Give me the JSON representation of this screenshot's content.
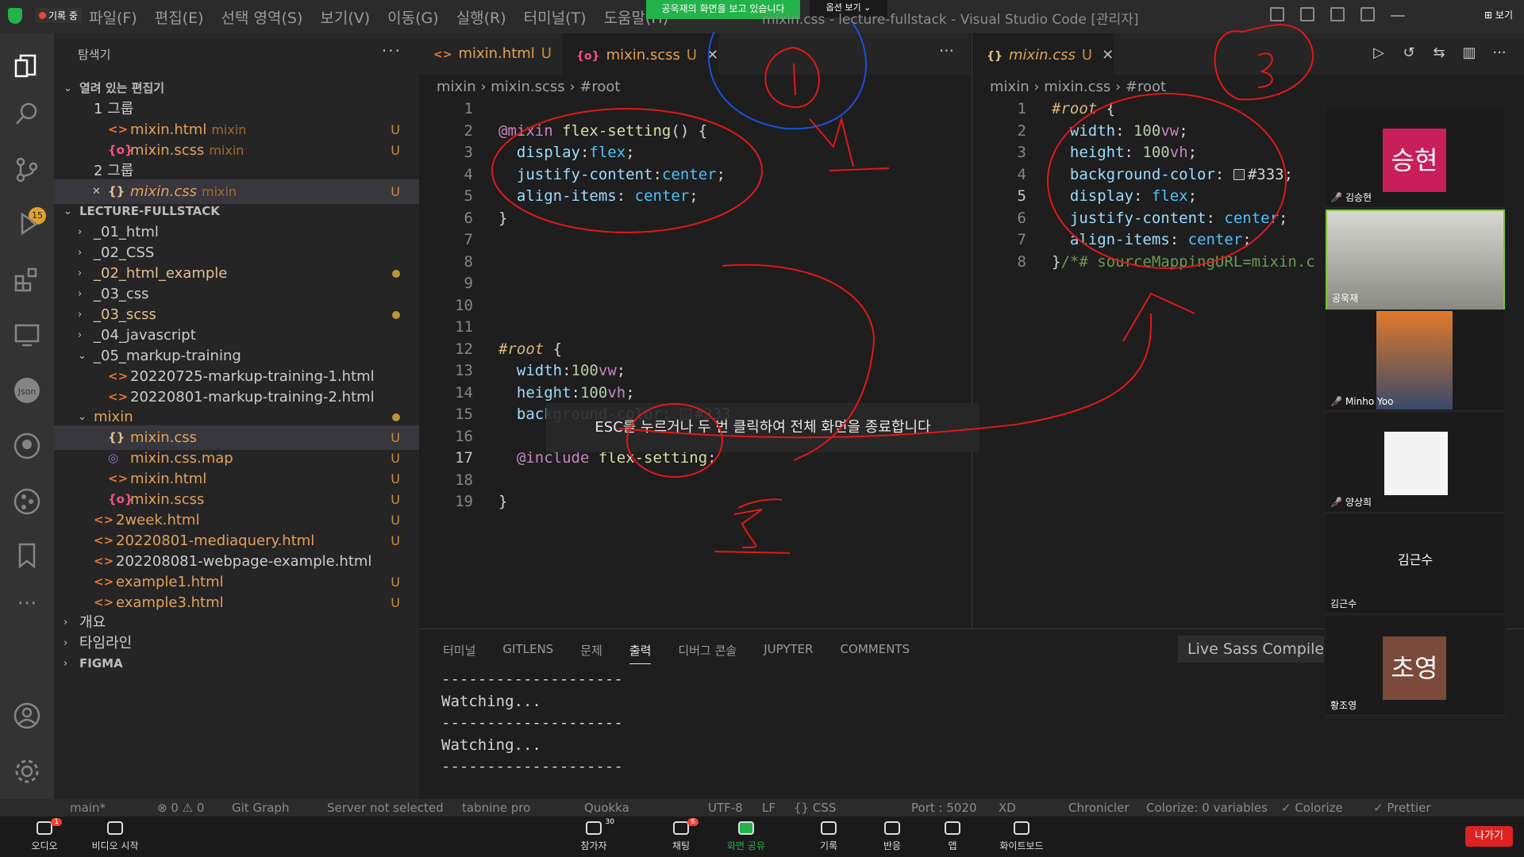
{
  "titlebar": {
    "menu": [
      "파일(F)",
      "편집(E)",
      "선택 영역(S)",
      "보기(V)",
      "이동(G)",
      "실행(R)",
      "터미널(T)",
      "도움말(H)"
    ],
    "record_label": "기록 중",
    "share_banner": "공욱재의 화면을 보고 있습니다",
    "view_options": "옵션 보기 ⌄",
    "window_title": "mixin.css - lecture-fullstack - Visual Studio Code [관리자]",
    "top_right_view": "보기"
  },
  "activity": {
    "scm_badge": "15"
  },
  "sidebar": {
    "title": "탐색기",
    "more": "···",
    "rows": [
      {
        "arrow": "⌄",
        "icon": "",
        "name": "열려 있는 편집기",
        "sub": "",
        "badge": "",
        "cls": "c-section",
        "indent": 0
      },
      {
        "arrow": "",
        "icon": "",
        "name": "1 그룹",
        "sub": "",
        "badge": "",
        "cls": "c-gray",
        "indent": 1
      },
      {
        "arrow": "",
        "icon": "<>",
        "name": "mixin.html",
        "sub": "mixin",
        "badge": "U",
        "cls": "c-orange",
        "indent": 2
      },
      {
        "arrow": "",
        "icon": "{o}",
        "name": "mixin.scss",
        "sub": "mixin",
        "badge": "U",
        "cls": "c-orange",
        "indent": 2
      },
      {
        "arrow": "",
        "icon": "",
        "name": "2 그룹",
        "sub": "",
        "badge": "",
        "cls": "c-gray",
        "indent": 1
      },
      {
        "arrow": "✕",
        "icon": "{}",
        "name": "mixin.css",
        "sub": "mixin",
        "badge": "U",
        "cls": "c-orange",
        "indent": 2,
        "sel": true,
        "italic": true
      },
      {
        "arrow": "⌄",
        "icon": "",
        "name": "LECTURE-FULLSTACK",
        "sub": "",
        "badge": "",
        "cls": "c-section",
        "indent": 0
      },
      {
        "arrow": "›",
        "icon": "",
        "name": "_01_html",
        "sub": "",
        "badge": "",
        "cls": "c-gray",
        "indent": 1
      },
      {
        "arrow": "›",
        "icon": "",
        "name": "_02_CSS",
        "sub": "",
        "badge": "",
        "cls": "c-gray",
        "indent": 1
      },
      {
        "arrow": "›",
        "icon": "",
        "name": "_02_html_example",
        "sub": "",
        "badge": "dot",
        "cls": "c-yellow",
        "indent": 1
      },
      {
        "arrow": "›",
        "icon": "",
        "name": "_03_css",
        "sub": "",
        "badge": "",
        "cls": "c-gray",
        "indent": 1
      },
      {
        "arrow": "›",
        "icon": "",
        "name": "_03_scss",
        "sub": "",
        "badge": "dot",
        "cls": "c-yellow",
        "indent": 1
      },
      {
        "arrow": "›",
        "icon": "",
        "name": "_04_javascript",
        "sub": "",
        "badge": "",
        "cls": "c-gray",
        "indent": 1
      },
      {
        "arrow": "⌄",
        "icon": "",
        "name": "_05_markup-training",
        "sub": "",
        "badge": "",
        "cls": "c-gray",
        "indent": 1
      },
      {
        "arrow": "",
        "icon": "<>",
        "name": "20220725-markup-training-1.html",
        "sub": "",
        "badge": "",
        "cls": "c-gray",
        "indent": 2
      },
      {
        "arrow": "",
        "icon": "<>",
        "name": "20220801-markup-training-2.html",
        "sub": "",
        "badge": "",
        "cls": "c-gray",
        "indent": 2
      },
      {
        "arrow": "⌄",
        "icon": "",
        "name": "mixin",
        "sub": "",
        "badge": "dot",
        "cls": "c-orange",
        "indent": 1
      },
      {
        "arrow": "",
        "icon": "{}",
        "name": "mixin.css",
        "sub": "",
        "badge": "U",
        "cls": "c-orange",
        "indent": 2,
        "sel": true
      },
      {
        "arrow": "",
        "icon": "◎",
        "name": "mixin.css.map",
        "sub": "",
        "badge": "U",
        "cls": "c-orange",
        "indent": 2
      },
      {
        "arrow": "",
        "icon": "<>",
        "name": "mixin.html",
        "sub": "",
        "badge": "U",
        "cls": "c-orange",
        "indent": 2
      },
      {
        "arrow": "",
        "icon": "{o}",
        "name": "mixin.scss",
        "sub": "",
        "badge": "U",
        "cls": "c-orange",
        "indent": 2
      },
      {
        "arrow": "",
        "icon": "<>",
        "name": "2week.html",
        "sub": "",
        "badge": "U",
        "cls": "c-orange",
        "indent": 1
      },
      {
        "arrow": "",
        "icon": "<>",
        "name": "20220801-mediaquery.html",
        "sub": "",
        "badge": "U",
        "cls": "c-orange",
        "indent": 1
      },
      {
        "arrow": "",
        "icon": "<>",
        "name": "202208081-webpage-example.html",
        "sub": "",
        "badge": "",
        "cls": "c-gray",
        "indent": 1
      },
      {
        "arrow": "",
        "icon": "<>",
        "name": "example1.html",
        "sub": "",
        "badge": "U",
        "cls": "c-orange",
        "indent": 1
      },
      {
        "arrow": "",
        "icon": "<>",
        "name": "example3.html",
        "sub": "",
        "badge": "U",
        "cls": "c-orange",
        "indent": 1
      },
      {
        "arrow": "›",
        "icon": "",
        "name": "개요",
        "sub": "",
        "badge": "",
        "cls": "c-gray",
        "indent": 0
      },
      {
        "arrow": "›",
        "icon": "",
        "name": "타임라인",
        "sub": "",
        "badge": "",
        "cls": "c-gray",
        "indent": 0
      },
      {
        "arrow": "›",
        "icon": "",
        "name": "FIGMA",
        "sub": "",
        "badge": "",
        "cls": "c-section",
        "indent": 0
      }
    ]
  },
  "editor1": {
    "tabs": [
      {
        "icon": "<>",
        "name": "mixin.html",
        "u": "U",
        "close": ""
      },
      {
        "icon": "{o}",
        "name": "mixin.scss",
        "u": "U",
        "close": "✕"
      }
    ],
    "crumbs": [
      "mixin",
      "mixin.scss",
      "#root"
    ],
    "lines": [
      [],
      [
        [
          "k-at",
          "@mixin"
        ],
        [
          "k-w",
          " "
        ],
        [
          "k-fn",
          "flex-setting"
        ],
        [
          "k-w",
          "() {"
        ]
      ],
      [
        [
          "k-w",
          "  "
        ],
        [
          "k-prop",
          "display"
        ],
        [
          "k-w",
          ":"
        ],
        [
          "k-val",
          "flex"
        ],
        [
          "k-w",
          ";"
        ]
      ],
      [
        [
          "k-w",
          "  "
        ],
        [
          "k-prop",
          "justify-content"
        ],
        [
          "k-w",
          ":"
        ],
        [
          "k-val",
          "center"
        ],
        [
          "k-w",
          ";"
        ]
      ],
      [
        [
          "k-w",
          "  "
        ],
        [
          "k-prop",
          "align-items"
        ],
        [
          "k-w",
          ": "
        ],
        [
          "k-val",
          "center"
        ],
        [
          "k-w",
          ";"
        ]
      ],
      [
        [
          "k-w",
          "}"
        ]
      ],
      [],
      [],
      [],
      [],
      [],
      [
        [
          "k-sel",
          "#root"
        ],
        [
          "k-w",
          " {"
        ]
      ],
      [
        [
          "k-w",
          "  "
        ],
        [
          "k-prop",
          "width"
        ],
        [
          "k-w",
          ":"
        ],
        [
          "k-num",
          "100"
        ],
        [
          "k-unit",
          "vw"
        ],
        [
          "k-w",
          ";"
        ]
      ],
      [
        [
          "k-w",
          "  "
        ],
        [
          "k-prop",
          "height"
        ],
        [
          "k-w",
          ":"
        ],
        [
          "k-num",
          "100"
        ],
        [
          "k-unit",
          "vh"
        ],
        [
          "k-w",
          ";"
        ]
      ],
      [
        [
          "k-w",
          "  "
        ],
        [
          "k-prop",
          "background-color"
        ],
        [
          "k-w",
          ": "
        ],
        [
          "swatch",
          ""
        ],
        [
          "k-w",
          "#333"
        ]
      ],
      [],
      [
        [
          "k-w",
          "  "
        ],
        [
          "k-at",
          "@include"
        ],
        [
          "k-w",
          " "
        ],
        [
          "k-fn",
          "flex-setting"
        ],
        [
          "k-w",
          ";"
        ]
      ],
      [],
      [
        [
          "k-w",
          "}"
        ]
      ]
    ],
    "current_line": 17
  },
  "editor2": {
    "tabs": [
      {
        "icon": "{}",
        "name": "mixin.css",
        "u": "U",
        "close": "✕"
      }
    ],
    "crumbs": [
      "mixin",
      "mixin.css",
      "#root"
    ],
    "lines": [
      [
        [
          "k-sel",
          "#root"
        ],
        [
          "k-w",
          " {"
        ]
      ],
      [
        [
          "k-w",
          "  "
        ],
        [
          "k-prop",
          "width"
        ],
        [
          "k-w",
          ": "
        ],
        [
          "k-num",
          "100"
        ],
        [
          "k-unit",
          "vw"
        ],
        [
          "k-w",
          ";"
        ]
      ],
      [
        [
          "k-w",
          "  "
        ],
        [
          "k-prop",
          "height"
        ],
        [
          "k-w",
          ": "
        ],
        [
          "k-num",
          "100"
        ],
        [
          "k-unit",
          "vh"
        ],
        [
          "k-w",
          ";"
        ]
      ],
      [
        [
          "k-w",
          "  "
        ],
        [
          "k-prop",
          "background-color"
        ],
        [
          "k-w",
          ": "
        ],
        [
          "swatch",
          ""
        ],
        [
          "k-w",
          "#333;"
        ]
      ],
      [
        [
          "k-w",
          "  "
        ],
        [
          "k-prop",
          "display"
        ],
        [
          "k-w",
          ": "
        ],
        [
          "k-val",
          "flex"
        ],
        [
          "k-w",
          ";"
        ]
      ],
      [
        [
          "k-w",
          "  "
        ],
        [
          "k-prop",
          "justify-content"
        ],
        [
          "k-w",
          ": "
        ],
        [
          "k-val",
          "center"
        ],
        [
          "k-w",
          ";"
        ]
      ],
      [
        [
          "k-w",
          "  "
        ],
        [
          "k-prop",
          "align-items"
        ],
        [
          "k-w",
          ": "
        ],
        [
          "k-val",
          "center"
        ],
        [
          "k-w",
          ";"
        ]
      ],
      [
        [
          "k-w",
          "}"
        ],
        [
          "k-cm",
          "/*# sourceMappingURL=mixin.c"
        ]
      ]
    ],
    "current_line": 5
  },
  "tooltip": "ESC를 누르거나 두 번 클릭하여 전체 화면을 종료합니다",
  "panel": {
    "tabs": [
      "터미널",
      "GITLENS",
      "문제",
      "출력",
      "디버그 콘솔",
      "JUPYTER",
      "COMMENTS"
    ],
    "active_tab": "출력",
    "output_channel": "Live Sass Compile",
    "output_lines": [
      "--------------------",
      "Watching...",
      "--------------------",
      "Watching...",
      "--------------------"
    ]
  },
  "statusbar": [
    "main*",
    "⊗ 0 ⚠ 0",
    "Git Graph",
    "Server not selected",
    "tabnine pro",
    "Quokka",
    "UTF-8",
    "LF",
    "{} CSS",
    "Port : 5020",
    "XD",
    "Chronicler",
    "Colorize: 0 variables",
    "✓ Colorize",
    "✓ Prettier"
  ],
  "zoom": {
    "items": [
      {
        "label": "오디오",
        "icon": "mic-icon"
      },
      {
        "label": "비디오 시작",
        "icon": "video-off-icon"
      },
      {
        "label": "참가자",
        "icon": "participants-icon",
        "count": "30"
      },
      {
        "label": "채팅",
        "icon": "chat-icon",
        "count": "6"
      },
      {
        "label": "화면 공유",
        "icon": "share-screen-icon"
      },
      {
        "label": "기록",
        "icon": "record-icon"
      },
      {
        "label": "반응",
        "icon": "reaction-icon"
      },
      {
        "label": "앱",
        "icon": "apps-icon"
      },
      {
        "label": "화이트보드",
        "icon": "whiteboard-icon"
      }
    ],
    "audio_badge": "1",
    "leave": "나가기"
  },
  "participants": [
    {
      "name": "김승현",
      "avatar": "승현",
      "color": "#c81e5a",
      "muted": true
    },
    {
      "name": "공욱재",
      "avatar": "",
      "color": "",
      "muted": false,
      "video": true
    },
    {
      "name": "Minho Yoo",
      "avatar": "",
      "color": "",
      "muted": true,
      "video": true
    },
    {
      "name": "양상희",
      "avatar": "",
      "color": "",
      "muted": true,
      "sketch": true
    },
    {
      "name": "김근수",
      "avatar": "",
      "color": "",
      "muted": false,
      "center": "김근수"
    },
    {
      "name": "황조영",
      "avatar": "초영",
      "color": "#7a4a3a",
      "muted": false
    }
  ]
}
